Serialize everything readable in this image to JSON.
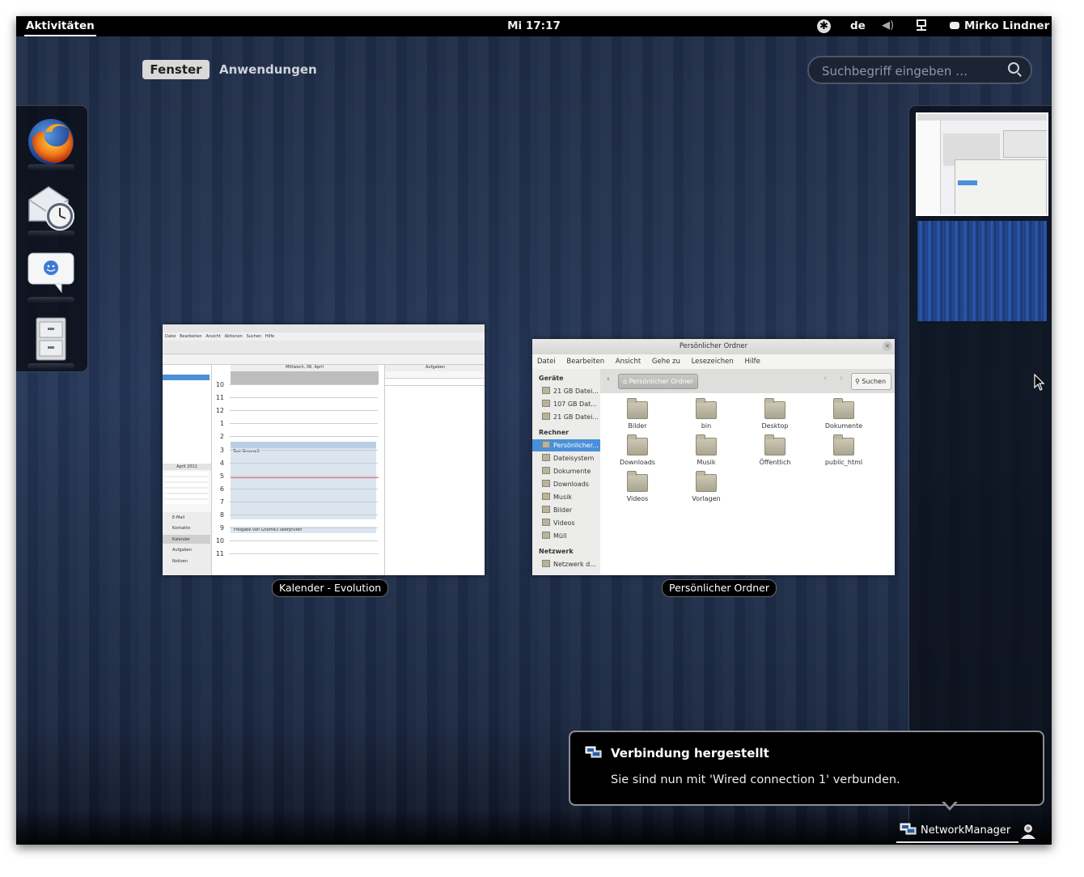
{
  "topbar": {
    "activities": "Aktivitäten",
    "clock": "Mi 17:17",
    "language": "de",
    "user": "Mirko Lindner"
  },
  "overview": {
    "tab_windows": "Fenster",
    "tab_applications": "Anwendungen",
    "search_placeholder": "Suchbegriff eingeben …"
  },
  "dash": {
    "items": [
      "firefox-icon",
      "evolution-mail-icon",
      "empathy-chat-icon",
      "file-cabinet-icon"
    ]
  },
  "windows": [
    {
      "caption": "Kalender - Evolution"
    },
    {
      "caption": "Persönlicher Ordner"
    }
  ],
  "evolution": {
    "menu": [
      "Datei",
      "Bearbeiten",
      "Ansicht",
      "Aktionen",
      "Suchen",
      "Hilfe"
    ],
    "date_header": "Mittwoch, 06. April",
    "tasks_header": "Aufgaben",
    "hours": [
      "10",
      "11",
      "12",
      "1",
      "2",
      "3",
      "4",
      "5",
      "6",
      "7",
      "8",
      "9",
      "10",
      "11"
    ],
    "sidebar": [
      "E-Mail",
      "Kontakte",
      "Kalender",
      "Aufgaben",
      "Notizen"
    ],
    "mini_cal_title": "April 2011",
    "event_label": "Test Gnome3",
    "event2_label": "Freigabe von Gnome3 überprüfen"
  },
  "files": {
    "title": "Persönlicher Ordner",
    "menu": [
      "Datei",
      "Bearbeiten",
      "Ansicht",
      "Gehe zu",
      "Lesezeichen",
      "Hilfe"
    ],
    "sidebar": [
      {
        "type": "header",
        "label": "Geräte"
      },
      {
        "type": "item",
        "label": "21 GB Datei..."
      },
      {
        "type": "item",
        "label": "107 GB Dat..."
      },
      {
        "type": "item",
        "label": "21 GB Datei..."
      },
      {
        "type": "header",
        "label": "Rechner"
      },
      {
        "type": "item",
        "label": "Persönlicher...",
        "selected": true
      },
      {
        "type": "item",
        "label": "Dateisystem"
      },
      {
        "type": "item",
        "label": "Dokumente"
      },
      {
        "type": "item",
        "label": "Downloads"
      },
      {
        "type": "item",
        "label": "Musik"
      },
      {
        "type": "item",
        "label": "Bilder"
      },
      {
        "type": "item",
        "label": "Videos"
      },
      {
        "type": "item",
        "label": "Müll"
      },
      {
        "type": "header",
        "label": "Netzwerk"
      },
      {
        "type": "item",
        "label": "Netzwerk d..."
      }
    ],
    "location": "Persönlicher Ordner",
    "search_button": "Suchen",
    "folders": [
      "Bilder",
      "bin",
      "Desktop",
      "Dokumente",
      "Downloads",
      "Musik",
      "Öffentlich",
      "public_html",
      "Videos",
      "Vorlagen"
    ]
  },
  "notification": {
    "title": "Verbindung hergestellt",
    "body": "Sie sind nun mit 'Wired connection 1' verbunden."
  },
  "tray": {
    "networkmanager": "NetworkManager"
  }
}
